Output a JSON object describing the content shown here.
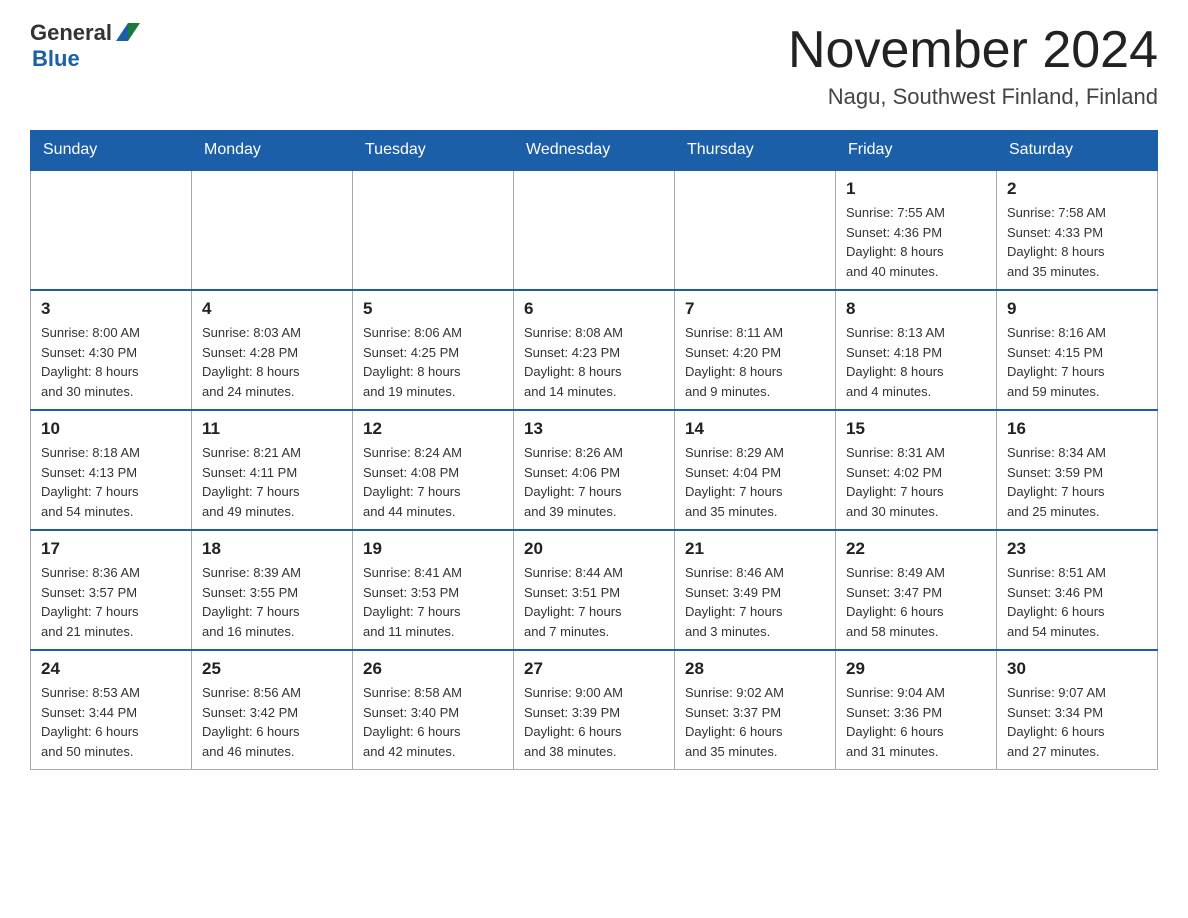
{
  "header": {
    "logo_text_general": "General",
    "logo_text_blue": "Blue",
    "month_title": "November 2024",
    "location": "Nagu, Southwest Finland, Finland"
  },
  "weekdays": [
    "Sunday",
    "Monday",
    "Tuesday",
    "Wednesday",
    "Thursday",
    "Friday",
    "Saturday"
  ],
  "weeks": [
    [
      {
        "day": "",
        "info": ""
      },
      {
        "day": "",
        "info": ""
      },
      {
        "day": "",
        "info": ""
      },
      {
        "day": "",
        "info": ""
      },
      {
        "day": "",
        "info": ""
      },
      {
        "day": "1",
        "info": "Sunrise: 7:55 AM\nSunset: 4:36 PM\nDaylight: 8 hours\nand 40 minutes."
      },
      {
        "day": "2",
        "info": "Sunrise: 7:58 AM\nSunset: 4:33 PM\nDaylight: 8 hours\nand 35 minutes."
      }
    ],
    [
      {
        "day": "3",
        "info": "Sunrise: 8:00 AM\nSunset: 4:30 PM\nDaylight: 8 hours\nand 30 minutes."
      },
      {
        "day": "4",
        "info": "Sunrise: 8:03 AM\nSunset: 4:28 PM\nDaylight: 8 hours\nand 24 minutes."
      },
      {
        "day": "5",
        "info": "Sunrise: 8:06 AM\nSunset: 4:25 PM\nDaylight: 8 hours\nand 19 minutes."
      },
      {
        "day": "6",
        "info": "Sunrise: 8:08 AM\nSunset: 4:23 PM\nDaylight: 8 hours\nand 14 minutes."
      },
      {
        "day": "7",
        "info": "Sunrise: 8:11 AM\nSunset: 4:20 PM\nDaylight: 8 hours\nand 9 minutes."
      },
      {
        "day": "8",
        "info": "Sunrise: 8:13 AM\nSunset: 4:18 PM\nDaylight: 8 hours\nand 4 minutes."
      },
      {
        "day": "9",
        "info": "Sunrise: 8:16 AM\nSunset: 4:15 PM\nDaylight: 7 hours\nand 59 minutes."
      }
    ],
    [
      {
        "day": "10",
        "info": "Sunrise: 8:18 AM\nSunset: 4:13 PM\nDaylight: 7 hours\nand 54 minutes."
      },
      {
        "day": "11",
        "info": "Sunrise: 8:21 AM\nSunset: 4:11 PM\nDaylight: 7 hours\nand 49 minutes."
      },
      {
        "day": "12",
        "info": "Sunrise: 8:24 AM\nSunset: 4:08 PM\nDaylight: 7 hours\nand 44 minutes."
      },
      {
        "day": "13",
        "info": "Sunrise: 8:26 AM\nSunset: 4:06 PM\nDaylight: 7 hours\nand 39 minutes."
      },
      {
        "day": "14",
        "info": "Sunrise: 8:29 AM\nSunset: 4:04 PM\nDaylight: 7 hours\nand 35 minutes."
      },
      {
        "day": "15",
        "info": "Sunrise: 8:31 AM\nSunset: 4:02 PM\nDaylight: 7 hours\nand 30 minutes."
      },
      {
        "day": "16",
        "info": "Sunrise: 8:34 AM\nSunset: 3:59 PM\nDaylight: 7 hours\nand 25 minutes."
      }
    ],
    [
      {
        "day": "17",
        "info": "Sunrise: 8:36 AM\nSunset: 3:57 PM\nDaylight: 7 hours\nand 21 minutes."
      },
      {
        "day": "18",
        "info": "Sunrise: 8:39 AM\nSunset: 3:55 PM\nDaylight: 7 hours\nand 16 minutes."
      },
      {
        "day": "19",
        "info": "Sunrise: 8:41 AM\nSunset: 3:53 PM\nDaylight: 7 hours\nand 11 minutes."
      },
      {
        "day": "20",
        "info": "Sunrise: 8:44 AM\nSunset: 3:51 PM\nDaylight: 7 hours\nand 7 minutes."
      },
      {
        "day": "21",
        "info": "Sunrise: 8:46 AM\nSunset: 3:49 PM\nDaylight: 7 hours\nand 3 minutes."
      },
      {
        "day": "22",
        "info": "Sunrise: 8:49 AM\nSunset: 3:47 PM\nDaylight: 6 hours\nand 58 minutes."
      },
      {
        "day": "23",
        "info": "Sunrise: 8:51 AM\nSunset: 3:46 PM\nDaylight: 6 hours\nand 54 minutes."
      }
    ],
    [
      {
        "day": "24",
        "info": "Sunrise: 8:53 AM\nSunset: 3:44 PM\nDaylight: 6 hours\nand 50 minutes."
      },
      {
        "day": "25",
        "info": "Sunrise: 8:56 AM\nSunset: 3:42 PM\nDaylight: 6 hours\nand 46 minutes."
      },
      {
        "day": "26",
        "info": "Sunrise: 8:58 AM\nSunset: 3:40 PM\nDaylight: 6 hours\nand 42 minutes."
      },
      {
        "day": "27",
        "info": "Sunrise: 9:00 AM\nSunset: 3:39 PM\nDaylight: 6 hours\nand 38 minutes."
      },
      {
        "day": "28",
        "info": "Sunrise: 9:02 AM\nSunset: 3:37 PM\nDaylight: 6 hours\nand 35 minutes."
      },
      {
        "day": "29",
        "info": "Sunrise: 9:04 AM\nSunset: 3:36 PM\nDaylight: 6 hours\nand 31 minutes."
      },
      {
        "day": "30",
        "info": "Sunrise: 9:07 AM\nSunset: 3:34 PM\nDaylight: 6 hours\nand 27 minutes."
      }
    ]
  ]
}
